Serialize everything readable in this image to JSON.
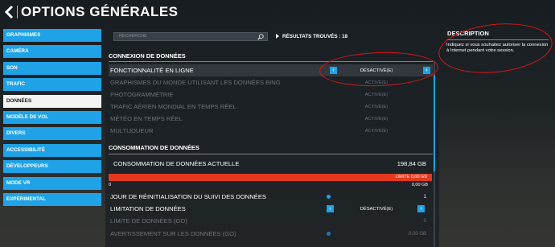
{
  "header": {
    "title": "OPTIONS GÉNÉRALES"
  },
  "sidebar": {
    "items": [
      {
        "label": "GRAPHISMES",
        "active": false
      },
      {
        "label": "CAMÉRA",
        "active": false
      },
      {
        "label": "SON",
        "active": false
      },
      {
        "label": "TRAFIC",
        "active": false
      },
      {
        "label": "DONNÉES",
        "active": true
      },
      {
        "label": "MODÈLE DE VOL",
        "active": false
      },
      {
        "label": "DIVERS",
        "active": false
      },
      {
        "label": "ACCESSIBILITÉ",
        "active": false
      },
      {
        "label": "DÉVELOPPEURS",
        "active": false
      },
      {
        "label": "MODE VR",
        "active": false
      },
      {
        "label": "EXPÉRIMENTAL",
        "active": false
      }
    ]
  },
  "search": {
    "placeholder": "RECHERCHE",
    "results": "RÉSULTATS TROUVÉS : 18"
  },
  "section1": {
    "title": "CONNEXION DE DONNÉES",
    "rows": [
      {
        "label": "FONCTIONNALITÉ EN LIGNE",
        "value": "DÉSACTIVÉ(E)"
      },
      {
        "label": "GRAPHISMES DU MONDE UTILISANT LES DONNÉES BING",
        "value": "ACTIVÉ(E)"
      },
      {
        "label": "PHOTOGRAMMÉTRIE",
        "value": "ACTIVÉ(E)"
      },
      {
        "label": "TRAFIC AÉRIEN MONDIAL EN TEMPS RÉEL",
        "value": "ACTIVÉ(E)"
      },
      {
        "label": "MÉTÉO EN TEMPS RÉEL",
        "value": "ACTIVÉ(E)"
      },
      {
        "label": "MULTIJOUEUR",
        "value": "ACTIVÉ(E)"
      }
    ]
  },
  "section2": {
    "title": "CONSOMMATION DE DONNÉES",
    "usage_label": "CONSOMMATION DE DONNÉES ACTUELLE",
    "usage_value": "198,84 GB",
    "bar_label": "LIMITE 0,00 GB",
    "bar_min": "0",
    "bar_max": "0,00 GB",
    "reset_label": "JOUR DE RÉINITIALISATION DU SUIVI DES DONNÉES",
    "reset_value": "1",
    "limit_label": "LIMITATION DE DONNÉES",
    "limit_value": "DÉSACTIVÉ(E)",
    "limit_gb_label": "LIMITE DE DONNÉES (GO)",
    "limit_gb_value": "0",
    "warn_label": "AVERTISSEMENT SUR LES DONNÉES (GO)",
    "warn_value": "0,00 GB"
  },
  "description": {
    "title": "DESCRIPTION",
    "text": "Indiquez si vous souhaitez autoriser la connexion à Internet pendant votre session."
  },
  "colors": {
    "accent": "#1fa2e6",
    "bar": "#e23a1f",
    "annotation": "#d81818"
  }
}
